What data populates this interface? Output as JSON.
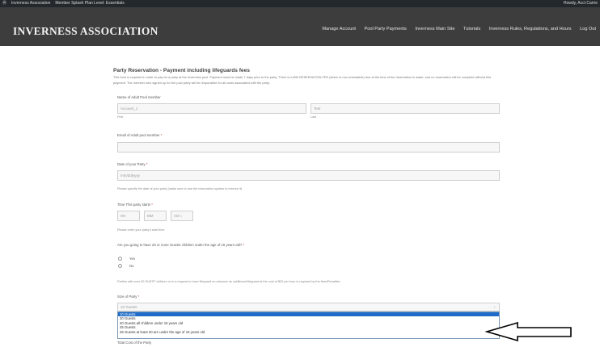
{
  "admin_bar": {
    "logo": "Ⓦ",
    "site": "Inverness Association",
    "member": "Member Splash Plan Level: Essentials",
    "greeting": "Howdy, Acct Carrie"
  },
  "header": {
    "title": "INVERNESS ASSOCIATION",
    "nav": [
      "Manage Account",
      "Pool Party Payments",
      "Inverness Main Site",
      "Tutorials",
      "Inverness Rules, Regulations, and Hours",
      "Log Out"
    ]
  },
  "form": {
    "heading": "Party Reservation - Payment including lifeguards fees",
    "intro": "This form is required in order to pay for a party at the Inverness pool. Payment must be made 7 days prior to the party. There is a $30 RESERVATION FEE (which is non-refundable) due at the time of the reservation is made, and no reservation will be complete without this payment. The member who signed up for the pool party will be responsible for all costs associated with the party.",
    "name_label": "Name of Adult Pool member",
    "first_value": "Account_1",
    "last_value": "Test",
    "first_sub": "First",
    "last_sub": "Last",
    "email_label": "Email of Adult pool member",
    "date_label": "Date of your Party",
    "date_placeholder": "mm/dd/yyyy",
    "date_help": "Please specify the date of your party (make sure to use the reservation system to reserve it)",
    "time_label": "Time This party starts",
    "hh": "HH",
    "mm": "MM",
    "ampm": "AM ↕",
    "time_help": "Please enter your party's start time",
    "guests_q": "Are you going to have 20 or more Guests children under the age of 15 years old?",
    "yes": "Yes",
    "no": "No",
    "guests_note": "Parties with over 20 GUEST children or in a request to have lifeguard on advance an additional lifeguard at the cost of $20 per hour is required by the fees/Penalties",
    "size_label": "Size of Party",
    "size_selected": "10 Guests",
    "size_arrow": "↕",
    "options": [
      "10 Guests",
      "20 Guests",
      "20 Guests all children under 15 years old",
      "25 Guests",
      "25 Guests at least 20 are under the age of 15 years old"
    ],
    "total_label": "Total Cost of the Party",
    "required_mark": "*"
  }
}
